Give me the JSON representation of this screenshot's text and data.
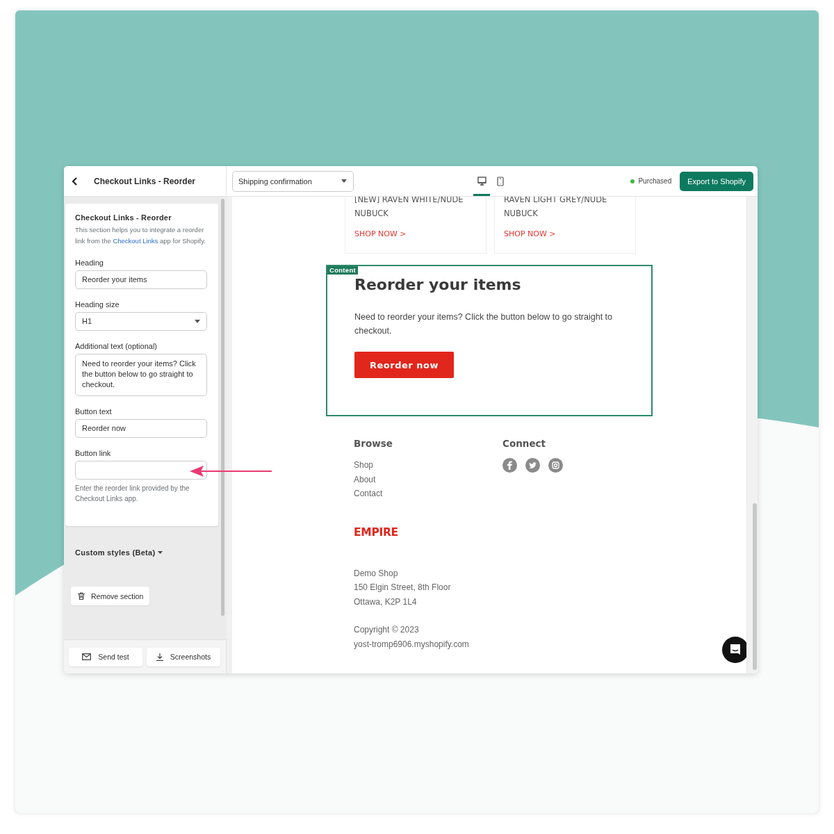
{
  "header": {
    "title": "Checkout Links - Reorder",
    "template_select": {
      "value": "Shipping confirmation"
    },
    "view_tabs": [
      {
        "kind": "desktop",
        "selected": true
      },
      {
        "kind": "mobile",
        "selected": false
      }
    ],
    "status": {
      "label": "Purchased",
      "color": "#3dba3f"
    },
    "export_button": "Export to Shopify"
  },
  "sidebar": {
    "section_title": "Checkout Links - Reorder",
    "description": {
      "before": "This section helps you to integrate a reorder link from the ",
      "link": "Checkout Links",
      "after": " app for Shopify."
    },
    "fields": [
      {
        "kind": "text",
        "label": "Heading",
        "value": "Reorder your items"
      },
      {
        "kind": "select",
        "label": "Heading size",
        "value": "H1"
      },
      {
        "kind": "textarea",
        "label": "Additional text (optional)",
        "value": "Need to reorder your items? Click the button below to go straight to checkout."
      },
      {
        "kind": "text",
        "label": "Button text",
        "value": "Reorder now"
      },
      {
        "kind": "text",
        "label": "Button link",
        "help": "Enter the reorder link provided by the Checkout Links app.",
        "highlighted": true
      }
    ],
    "custom_styles": {
      "label": "Custom styles (Beta)",
      "expanded": false
    },
    "remove_button": "Remove section",
    "footer_buttons": [
      {
        "kind": "mail",
        "label": "Send test"
      },
      {
        "kind": "download",
        "label": "Screenshots"
      }
    ]
  },
  "preview": {
    "products": [
      {
        "name": "[NEW] RAVEN WHITE/NUDE",
        "name_2": "NUBUCK",
        "link": "SHOP NOW >"
      },
      {
        "name": "RAVEN LIGHT GREY/NUDE",
        "name_2": "NUBUCK",
        "link": "SHOP NOW >"
      }
    ],
    "content_block": {
      "tag": "Content",
      "heading": "Reorder your items",
      "text": "Need to reorder your items? Click the button below to go straight to checkout.",
      "button": "Reorder now"
    },
    "footer": {
      "browse_title": "Browse",
      "links": [
        "Shop",
        "About",
        "Contact"
      ],
      "connect_title": "Connect",
      "socials": [
        {
          "kind": "facebook"
        },
        {
          "kind": "twitter"
        },
        {
          "kind": "instagram"
        }
      ],
      "logo": "EMPIRE",
      "address": [
        "Demo Shop",
        "150 Elgin Street, 8th Floor",
        "Ottawa, K2P 1L4"
      ],
      "copyright": [
        "Copyright © 2023",
        "yost-tromp6906.myshopify.com"
      ]
    }
  }
}
